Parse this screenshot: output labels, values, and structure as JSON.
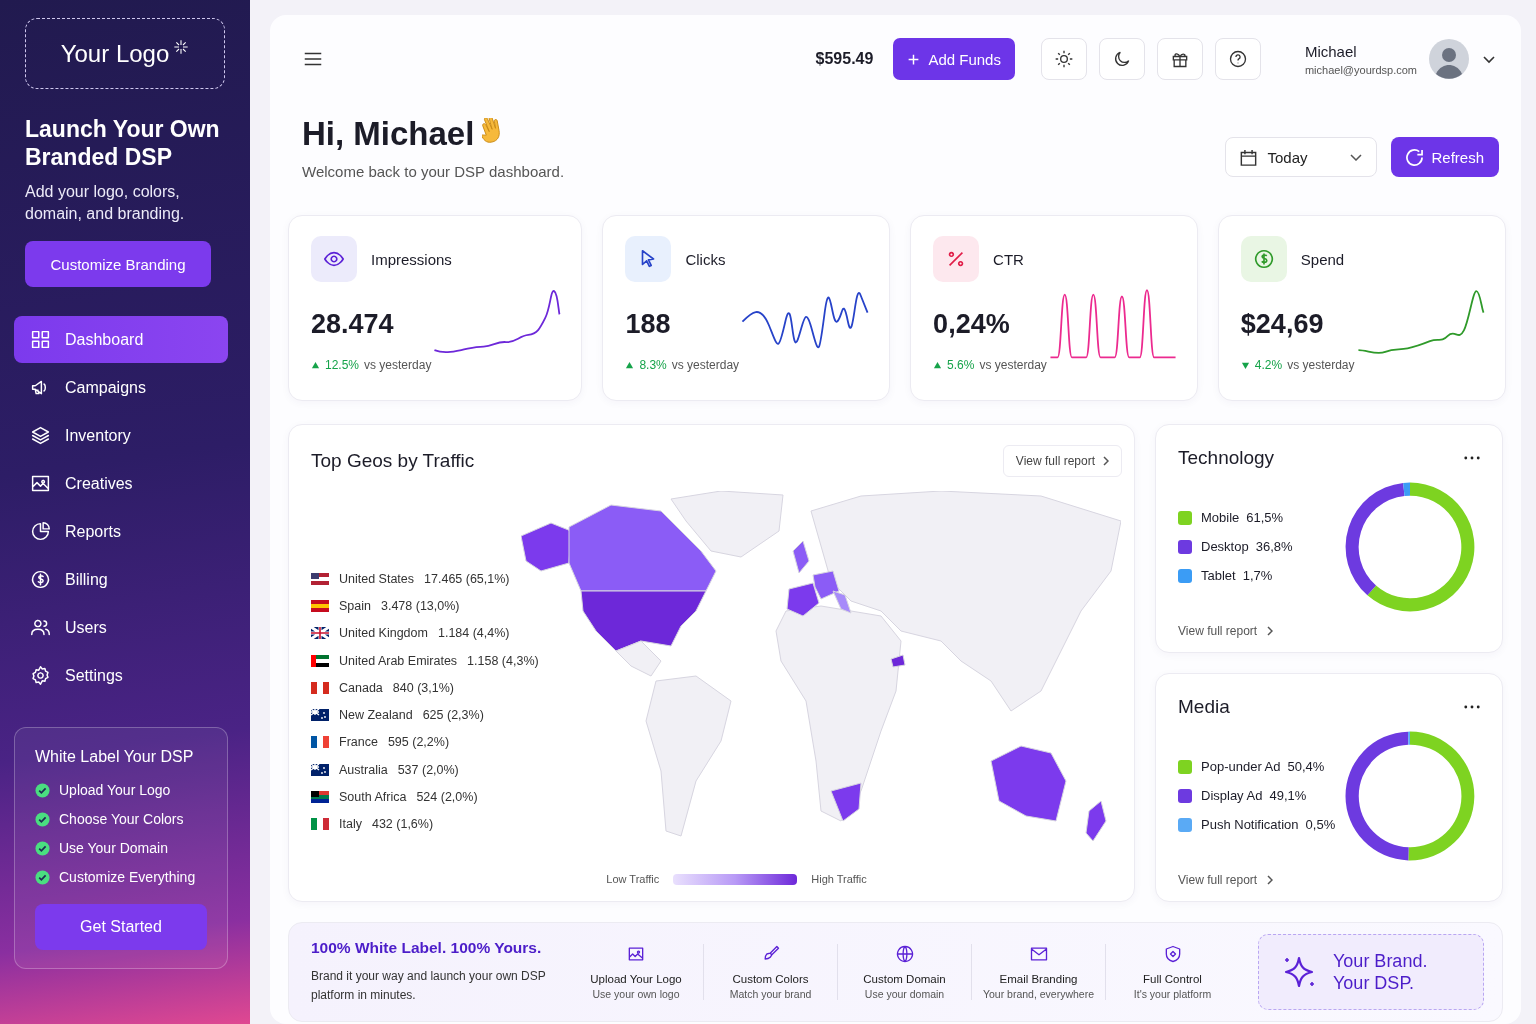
{
  "sidebar": {
    "logo": "Your Logo",
    "promo_title": "Launch Your Own Branded DSP",
    "promo_text": "Add your logo, colors, domain, and branding.",
    "promo_button": "Customize Branding",
    "nav": [
      {
        "label": "Dashboard",
        "selected": true
      },
      {
        "label": "Campaigns",
        "selected": false
      },
      {
        "label": "Inventory",
        "selected": false
      },
      {
        "label": "Creatives",
        "selected": false
      },
      {
        "label": "Reports",
        "selected": false
      },
      {
        "label": "Billing",
        "selected": false
      },
      {
        "label": "Users",
        "selected": false
      },
      {
        "label": "Settings",
        "selected": false
      }
    ],
    "white_label": {
      "title": "White Label Your DSP",
      "items": [
        {
          "label": "Upload Your Logo",
          "checked": true
        },
        {
          "label": "Choose Your Colors",
          "checked": true
        },
        {
          "label": "Use Your Domain",
          "checked": true
        },
        {
          "label": "Customize Everything",
          "checked": true
        }
      ],
      "button": "Get Started"
    }
  },
  "topbar": {
    "balance": "$595.49",
    "add_funds": "Add Funds",
    "user": {
      "name": "Michael",
      "email": "michael@yourdsp.com"
    }
  },
  "header": {
    "greeting": "Hi, Michael",
    "subtitle": "Welcome back to your DSP dashboard.",
    "date_range": "Today",
    "refresh": "Refresh"
  },
  "metrics": [
    {
      "label": "Impressions",
      "value": "28.474",
      "change": "12.5%",
      "compare": "vs yesterday",
      "falling": false,
      "color": "#6d28d9"
    },
    {
      "label": "Clicks",
      "value": "188",
      "change": "8.3%",
      "compare": "vs yesterday",
      "falling": false,
      "color": "#2743c9"
    },
    {
      "label": "CTR",
      "value": "0,24%",
      "change": "5.6%",
      "compare": "vs yesterday",
      "falling": false,
      "color": "#ec2a8f"
    },
    {
      "label": "Spend",
      "value": "$24,69",
      "change": "4.2%",
      "compare": "vs yesterday",
      "falling": true,
      "color": "#2f9a2a"
    }
  ],
  "geos": {
    "title": "Top Geos by Traffic",
    "view_report": "View full report",
    "rows": [
      {
        "country": "United States",
        "value": "17.465 (65,1%)"
      },
      {
        "country": "Spain",
        "value": "3.478 (13,0%)"
      },
      {
        "country": "United Kingdom",
        "value": "1.184 (4,4%)"
      },
      {
        "country": "United Arab Emirates",
        "value": "1.158 (4,3%)"
      },
      {
        "country": "Canada",
        "value": "840 (3,1%)"
      },
      {
        "country": "New Zealand",
        "value": "625 (2,3%)"
      },
      {
        "country": "France",
        "value": "595 (2,2%)"
      },
      {
        "country": "Australia",
        "value": "537 (2,0%)"
      },
      {
        "country": "South Africa",
        "value": "524 (2,0%)"
      },
      {
        "country": "Italy",
        "value": "432 (1,6%)"
      }
    ],
    "legend_low": "Low Traffic",
    "legend_high": "High Traffic"
  },
  "breakdowns": [
    {
      "title": "Technology",
      "view_report": "View full report",
      "items": [
        {
          "value": "61,5%",
          "color": "#7ed321"
        },
        {
          "value": "36,8%",
          "color": "#6d3ae0"
        },
        {
          "value": "1,7%",
          "color": "#3b9cf5"
        }
      ],
      "chart_data": {
        "type": "donut",
        "categories": [
          "Mobile",
          "Desktop",
          "Tablet"
        ],
        "values": [
          61.5,
          36.8,
          1.7
        ]
      }
    },
    {
      "title": "Media",
      "view_report": "View full report",
      "items": [
        {
          "value": "50,4%",
          "color": "#7ed321"
        },
        {
          "value": "49,1%",
          "color": "#6d3ae0"
        },
        {
          "value": "0,5%",
          "color": "#5aaaf5"
        }
      ],
      "chart_data": {
        "type": "donut",
        "categories": [
          "Pop-under Ad",
          "Display Ad",
          "Push Notification"
        ],
        "values": [
          50.4,
          49.1,
          0.5
        ]
      }
    }
  ],
  "banner": {
    "title": "100% White Label. 100% Yours.",
    "text": "Brand it your way and launch your own DSP platform in minutes.",
    "features": [
      {
        "title": "Upload Your Logo",
        "subtitle": "Use your own logo"
      },
      {
        "title": "Custom Colors",
        "subtitle": "Match your brand"
      },
      {
        "title": "Custom Domain",
        "subtitle": "Use your domain"
      },
      {
        "title": "Email Branding",
        "subtitle": "Your brand, everywhere"
      },
      {
        "title": "Full Control",
        "subtitle": "It's your platform"
      }
    ],
    "brand_lines": [
      "Your Brand.",
      "Your DSP."
    ]
  }
}
